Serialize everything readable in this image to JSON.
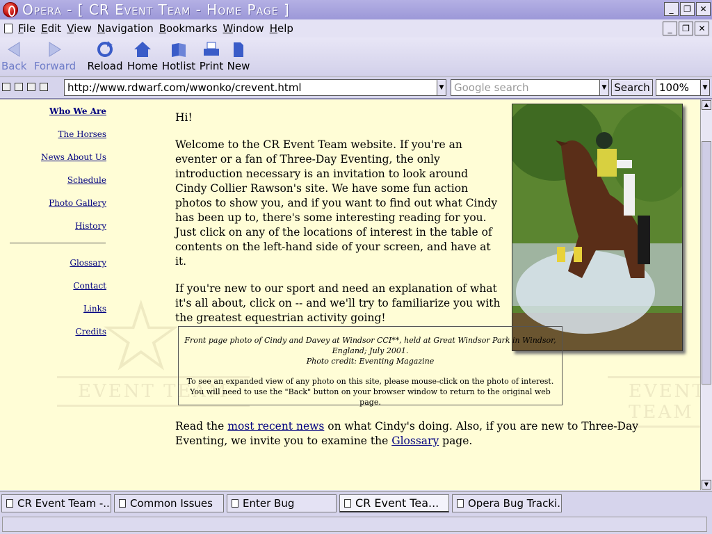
{
  "window": {
    "title": "Opera - [ CR Event Team - Home Page ]",
    "controls": [
      "_",
      "❐",
      "✕"
    ]
  },
  "menu": {
    "items": [
      {
        "key": "F",
        "rest": "ile"
      },
      {
        "key": "E",
        "rest": "dit"
      },
      {
        "key": "V",
        "rest": "iew"
      },
      {
        "key": "N",
        "rest": "avigation"
      },
      {
        "key": "B",
        "rest": "ookmarks"
      },
      {
        "key": "W",
        "rest": "indow"
      },
      {
        "key": "H",
        "rest": "elp"
      }
    ]
  },
  "toolbar": {
    "back": "Back",
    "forward": "Forward",
    "reload": "Reload",
    "home": "Home",
    "hotlist": "Hotlist",
    "print": "Print",
    "new": "New",
    "accent": "#3a5cc8"
  },
  "address": {
    "url": "http://www.rdwarf.com/wwonko/crevent.html",
    "search_placeholder": "Google search",
    "search_button": "Search",
    "zoom": "100%"
  },
  "nav": {
    "items": [
      "Who We Are",
      "The Horses",
      "News About Us",
      "Schedule",
      "Photo Gallery",
      "History",
      "Glossary",
      "Contact",
      "Links",
      "Credits"
    ]
  },
  "content": {
    "greeting": "Hi!",
    "para1": "Welcome to the CR Event Team website. If you're an eventer or a fan of Three-Day Eventing, the only introduction necessary is an invitation to look around Cindy Collier Rawson's site. We have some fun action photos to show you, and if you want to find out what Cindy has been up to, there's some interesting reading for you. Just click on any of the locations of interest in the table of contents on the left-hand side of your screen, and have at it.",
    "para2": "If you're new to our sport and need an explanation of what it's all about, click on -- and we'll try to familiarize you with the greatest equestrian activity going!",
    "caption_line1": "Front page photo of Cindy and Davey at Windsor CCI**, held at Great Windsor Park in Windsor, England; July 2001.",
    "caption_line2": "Photo credit: Eventing Magazine",
    "caption_line3": "To see an expanded view of any photo on this site, please mouse-click on the photo of interest.",
    "caption_line4": "You will need to use the \"Back\" button on your browser window to return to the original web page.",
    "bottom_pre": "Read the ",
    "bottom_link1": "most recent news",
    "bottom_mid": " on what Cindy's doing. Also, if you are new to Three-Day Eventing, we invite you to examine the ",
    "bottom_link2": "Glossary",
    "bottom_post": " page.",
    "watermark": "EVENT TEAM"
  },
  "tabs": [
    {
      "label": "CR Event Team -...",
      "active": false
    },
    {
      "label": "Common Issues",
      "active": false
    },
    {
      "label": "Enter Bug",
      "active": false
    },
    {
      "label": "CR Event Tea...",
      "active": true
    },
    {
      "label": "Opera Bug Tracki...",
      "active": false
    }
  ]
}
